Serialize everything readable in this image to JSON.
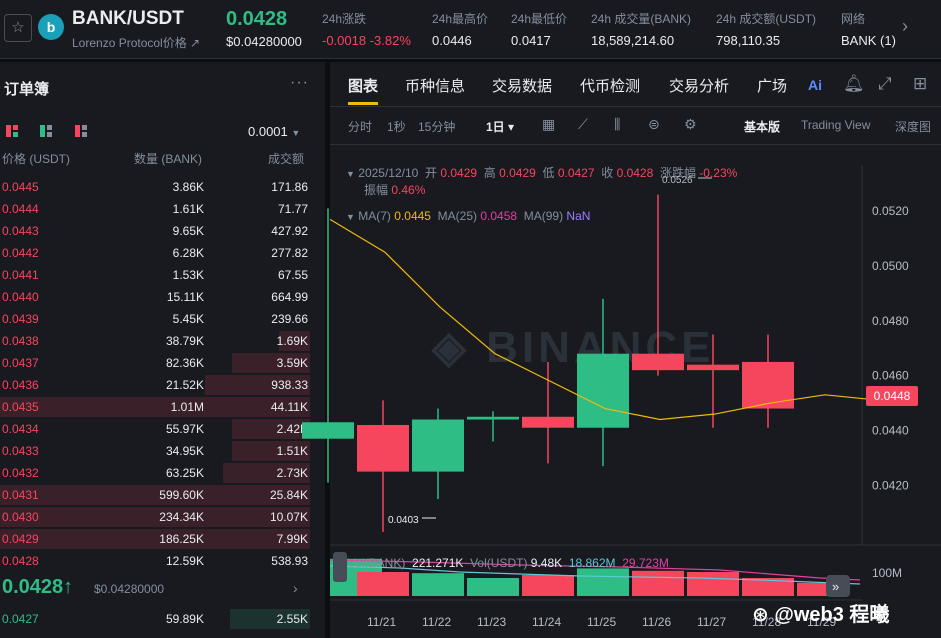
{
  "header": {
    "pair": "BANK/USDT",
    "subname": "Lorenzo Protocol价格 ↗",
    "last_price": "0.0428",
    "last_price_usd": "$0.04280000",
    "stats": [
      {
        "label": "24h涨跌",
        "value": "-0.0018 -3.82%"
      },
      {
        "label": "24h最高价",
        "value": "0.0446"
      },
      {
        "label": "24h最低价",
        "value": "0.0417"
      },
      {
        "label": "24h 成交量(BANK)",
        "value": "18,589,214.60"
      },
      {
        "label": "24h 成交额(USDT)",
        "value": "798,110.35"
      },
      {
        "label": "网络",
        "value": "BANK (1)"
      }
    ]
  },
  "orderbook": {
    "title": "订单簿",
    "precision": "0.0001",
    "col_price": "价格 (USDT)",
    "col_qty": "数量 (BANK)",
    "col_total": "成交额",
    "asks": [
      {
        "price": "0.0445",
        "qty": "3.86K",
        "total": "171.86",
        "depth": 0.0
      },
      {
        "price": "0.0444",
        "qty": "1.61K",
        "total": "71.77",
        "depth": 0.0
      },
      {
        "price": "0.0443",
        "qty": "9.65K",
        "total": "427.92",
        "depth": 0.0
      },
      {
        "price": "0.0442",
        "qty": "6.28K",
        "total": "277.82",
        "depth": 0.0
      },
      {
        "price": "0.0441",
        "qty": "1.53K",
        "total": "67.55",
        "depth": 0.0
      },
      {
        "price": "0.0440",
        "qty": "15.11K",
        "total": "664.99",
        "depth": 0.0
      },
      {
        "price": "0.0439",
        "qty": "5.45K",
        "total": "239.66",
        "depth": 0.0
      },
      {
        "price": "0.0438",
        "qty": "38.79K",
        "total": "1.69K",
        "depth": 0.1
      },
      {
        "price": "0.0437",
        "qty": "82.36K",
        "total": "3.59K",
        "depth": 0.25
      },
      {
        "price": "0.0436",
        "qty": "21.52K",
        "total": "938.33",
        "depth": 0.34
      },
      {
        "price": "0.0435",
        "qty": "1.01M",
        "total": "44.11K",
        "depth": 1.0
      },
      {
        "price": "0.0434",
        "qty": "55.97K",
        "total": "2.42K",
        "depth": 0.25
      },
      {
        "price": "0.0433",
        "qty": "34.95K",
        "total": "1.51K",
        "depth": 0.25
      },
      {
        "price": "0.0432",
        "qty": "63.25K",
        "total": "2.73K",
        "depth": 0.28
      },
      {
        "price": "0.0431",
        "qty": "599.60K",
        "total": "25.84K",
        "depth": 1.0
      },
      {
        "price": "0.0430",
        "qty": "234.34K",
        "total": "10.07K",
        "depth": 1.0
      },
      {
        "price": "0.0429",
        "qty": "186.25K",
        "total": "7.99K",
        "depth": 1.0
      },
      {
        "price": "0.0428",
        "qty": "12.59K",
        "total": "538.93",
        "depth": 0.0
      }
    ],
    "mid_price": "0.0428↑",
    "mid_usd": "$0.04280000",
    "bids": [
      {
        "price": "0.0427",
        "qty": "59.89K",
        "total": "2.55K"
      }
    ]
  },
  "chart_panel": {
    "tabs": [
      "图表",
      "币种信息",
      "交易数据",
      "代币检测",
      "交易分析",
      "广场"
    ],
    "intervals": [
      "分时",
      "1秒",
      "15分钟",
      "1日 ▾"
    ],
    "views": [
      "基本版",
      "Trading View",
      "深度图"
    ],
    "ohlc": {
      "date": "2025/12/10",
      "open_label": "开",
      "open": "0.0429",
      "high_label": "高",
      "high": "0.0429",
      "low_label": "低",
      "low": "0.0427",
      "close_label": "收",
      "close": "0.0428",
      "chg_label": "涨跌幅",
      "chg": "-0.23%",
      "amp_label": "振幅",
      "amp": "0.46%"
    },
    "ma": {
      "ma7_label": "MA(7)",
      "ma7": "0.0445",
      "ma25_label": "MA(25)",
      "ma25": "0.0458",
      "ma99_label": "MA(99)",
      "ma99": "NaN"
    },
    "vol": {
      "label": "Vol(BANK)",
      "value": "221.271K",
      "usdt_label": "Vol(USDT)",
      "usdt": "9.48K",
      "ma1": "18.862M",
      "ma2": "29.723M"
    },
    "price_tag": "0.0448",
    "watermark": "BINANCE",
    "annot_high": "0.0526",
    "annot_low": "0.0403",
    "vol_axis": "100M"
  },
  "chart_data": {
    "type": "candlestick",
    "categories": [
      "11/21",
      "11/22",
      "11/23",
      "11/24",
      "11/25",
      "11/26",
      "11/27",
      "11/28",
      "11/29"
    ],
    "candles": [
      {
        "x": "11/20",
        "open": 0.0437,
        "close": 0.0443,
        "high": 0.0521,
        "low": 0.0421
      },
      {
        "x": "11/21",
        "open": 0.0442,
        "close": 0.0425,
        "high": 0.0451,
        "low": 0.0403
      },
      {
        "x": "11/22",
        "open": 0.0425,
        "close": 0.0444,
        "high": 0.0448,
        "low": 0.0415
      },
      {
        "x": "11/23",
        "open": 0.0444,
        "close": 0.0445,
        "high": 0.0447,
        "low": 0.0436
      },
      {
        "x": "11/24",
        "open": 0.0445,
        "close": 0.0441,
        "high": 0.0465,
        "low": 0.0428
      },
      {
        "x": "11/25",
        "open": 0.0441,
        "close": 0.0468,
        "high": 0.0488,
        "low": 0.0427
      },
      {
        "x": "11/26",
        "open": 0.0468,
        "close": 0.0462,
        "high": 0.0526,
        "low": 0.046
      },
      {
        "x": "11/27",
        "open": 0.0464,
        "close": 0.0462,
        "high": 0.0475,
        "low": 0.0441
      },
      {
        "x": "11/28",
        "open": 0.0465,
        "close": 0.0448,
        "high": 0.0475,
        "low": 0.0441
      }
    ],
    "ma7": [
      0.0517,
      0.0505,
      0.0485,
      0.0468,
      0.0458,
      0.0448,
      0.0444,
      0.0446,
      0.045,
      0.0453,
      0.0451
    ],
    "yticks": [
      "0.0520",
      "0.0500",
      "0.0480",
      "0.0460",
      "0.0440",
      "0.0420"
    ],
    "ylim": [
      0.0411,
      0.0535
    ],
    "volumes": [
      62,
      40,
      38,
      30,
      35,
      46,
      42,
      40,
      30,
      22
    ],
    "volume_colors": [
      "green",
      "red",
      "green",
      "green",
      "red",
      "green",
      "red",
      "red",
      "red",
      "red"
    ]
  },
  "colors": {
    "up": "#2ebd85",
    "down": "#f6465d",
    "ma7": "#f0b90b",
    "accent": "#f0b90b"
  }
}
